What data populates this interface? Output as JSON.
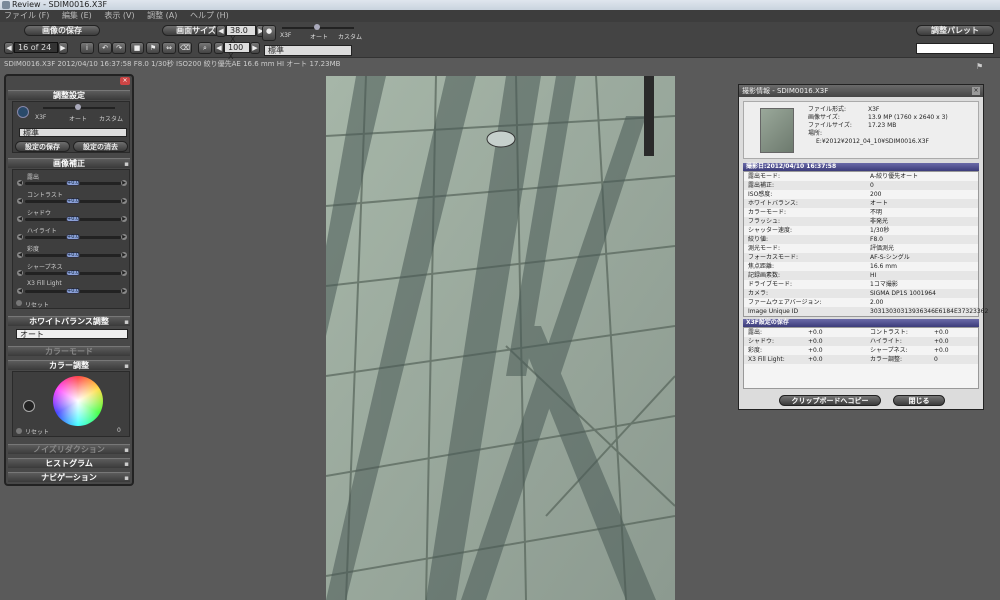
{
  "app": {
    "title": "Review - SDIM0016.X3F"
  },
  "menu": [
    "ファイル (F)",
    "編集 (E)",
    "表示 (V)",
    "調整 (A)",
    "ヘルプ (H)"
  ],
  "toolbar": {
    "save_label": "画像の保存",
    "screensize_label": "画面サイズ",
    "zoom_value": "38.0 X",
    "mode_left": "X3F",
    "mode_mid": "オート",
    "mode_right": "カスタム",
    "page_indicator": "16 of 24",
    "zoom2_value": "100 X",
    "preset_value": "標準",
    "palette_label": "調整パレット"
  },
  "info_line": "SDIM0016.X3F 2012/04/10 16:37:58 F8.0 1/30秒 ISO200 絞り優先AE 16.6 mm HI オート 17.23MB",
  "panel": {
    "adjust_title": "調整設定",
    "mode_x3f": "X3F",
    "mode_auto": "オート",
    "mode_custom": "カスタム",
    "preset_value": "標準",
    "save_setting": "設定の保存",
    "delete_setting": "設定の消去",
    "image_correction": "画像補正",
    "sliders": [
      {
        "label": "露出",
        "value": "+0.0"
      },
      {
        "label": "コントラスト",
        "value": "+0.0"
      },
      {
        "label": "シャドウ",
        "value": "+0.0"
      },
      {
        "label": "ハイライト",
        "value": "+0.0"
      },
      {
        "label": "彩度",
        "value": "+0.0"
      },
      {
        "label": "シャープネス",
        "value": "+0.0"
      },
      {
        "label": "X3 Fill Light",
        "value": "+0.0"
      }
    ],
    "reset": "リセット",
    "wb_title": "ホワイトバランス調整",
    "wb_value": "オート",
    "color_mode": "カラーモード",
    "color_adjust": "カラー調整",
    "reset2": "リセット",
    "color_num": "0",
    "noise": "ノイズリダクション",
    "histogram": "ヒストグラム",
    "navigation": "ナビゲーション"
  },
  "dialog": {
    "title": "撮影情報 - SDIM0016.X3F",
    "summary": [
      {
        "k": "ファイル形式:",
        "v": "X3F"
      },
      {
        "k": "画像サイズ:",
        "v": "13.9 MP (1760 x 2640 x 3)"
      },
      {
        "k": "ファイルサイズ:",
        "v": "17.23 MB"
      },
      {
        "k": "場所:",
        "v": ""
      },
      {
        "k": "",
        "v": "E:¥2012¥2012_04_10¥SDIM0016.X3F"
      }
    ],
    "shoot_header": "撮影日:2012/04/10 16:37:58",
    "shoot_rows": [
      {
        "k": "露出モード:",
        "v": "A-絞り優先オート"
      },
      {
        "k": "露出補正:",
        "v": "0"
      },
      {
        "k": "ISO感度:",
        "v": "200"
      },
      {
        "k": "ホワイトバランス:",
        "v": "オート"
      },
      {
        "k": "カラーモード:",
        "v": "不明"
      },
      {
        "k": "フラッシュ:",
        "v": "非発光"
      },
      {
        "k": "シャッター速度:",
        "v": "1/30秒"
      },
      {
        "k": "絞り値:",
        "v": "F8.0"
      },
      {
        "k": "測光モード:",
        "v": "評価測光"
      },
      {
        "k": "フォーカスモード:",
        "v": "AF-S-シングル"
      },
      {
        "k": "焦点距離:",
        "v": "16.6 mm"
      },
      {
        "k": "記録画素数:",
        "v": "HI"
      },
      {
        "k": "ドライブモード:",
        "v": "1コマ撮影"
      },
      {
        "k": "カメラ:",
        "v": "SIGMA DP1S 1001964"
      },
      {
        "k": "ファームウェアバージョン:",
        "v": "2.00"
      },
      {
        "k": "Image Unique ID",
        "v": "30313030313936346E6184E37323362"
      }
    ],
    "x3f_header": "X3F設定の保存",
    "x3f_rows": [
      {
        "k1": "露出:",
        "v1": "+0.0",
        "k2": "コントラスト:",
        "v2": "+0.0"
      },
      {
        "k1": "シャドウ:",
        "v1": "+0.0",
        "k2": "ハイライト:",
        "v2": "+0.0"
      },
      {
        "k1": "彩度:",
        "v1": "+0.0",
        "k2": "シャープネス:",
        "v2": "+0.0"
      },
      {
        "k1": "X3 Fill Light:",
        "v1": "+0.0",
        "k2": "カラー調整:",
        "v2": "0"
      }
    ],
    "copy_btn": "クリップボードへコピー",
    "close_btn": "閉じる"
  }
}
